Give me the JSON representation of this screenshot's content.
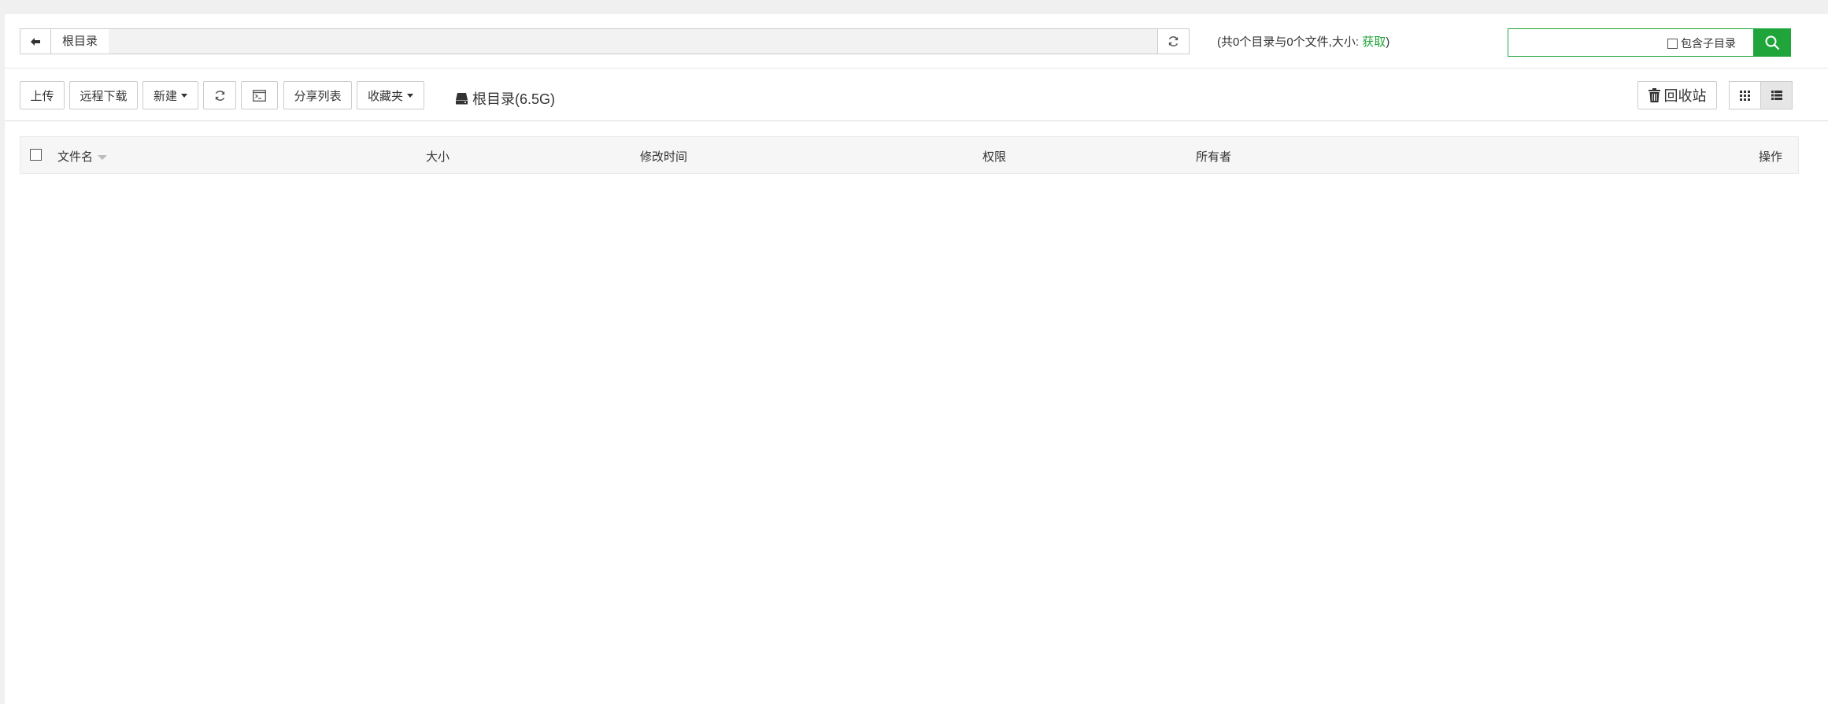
{
  "pathbar": {
    "crumb": "根目录",
    "summary_prefix": "(共0个目录与0个文件,大小: ",
    "summary_link": "获取",
    "summary_suffix": ")"
  },
  "search": {
    "placeholder": "",
    "subdir_label": "包含子目录"
  },
  "toolbar": {
    "upload": "上传",
    "remote_download": "远程下载",
    "new": "新建",
    "share_list": "分享列表",
    "favorites": "收藏夹",
    "disk_label": "根目录(6.5G)",
    "recycle_bin": "回收站"
  },
  "table": {
    "columns": [
      "文件名",
      "大小",
      "修改时间",
      "权限",
      "所有者",
      "操作"
    ]
  },
  "colors": {
    "accent": "#20a53a"
  }
}
